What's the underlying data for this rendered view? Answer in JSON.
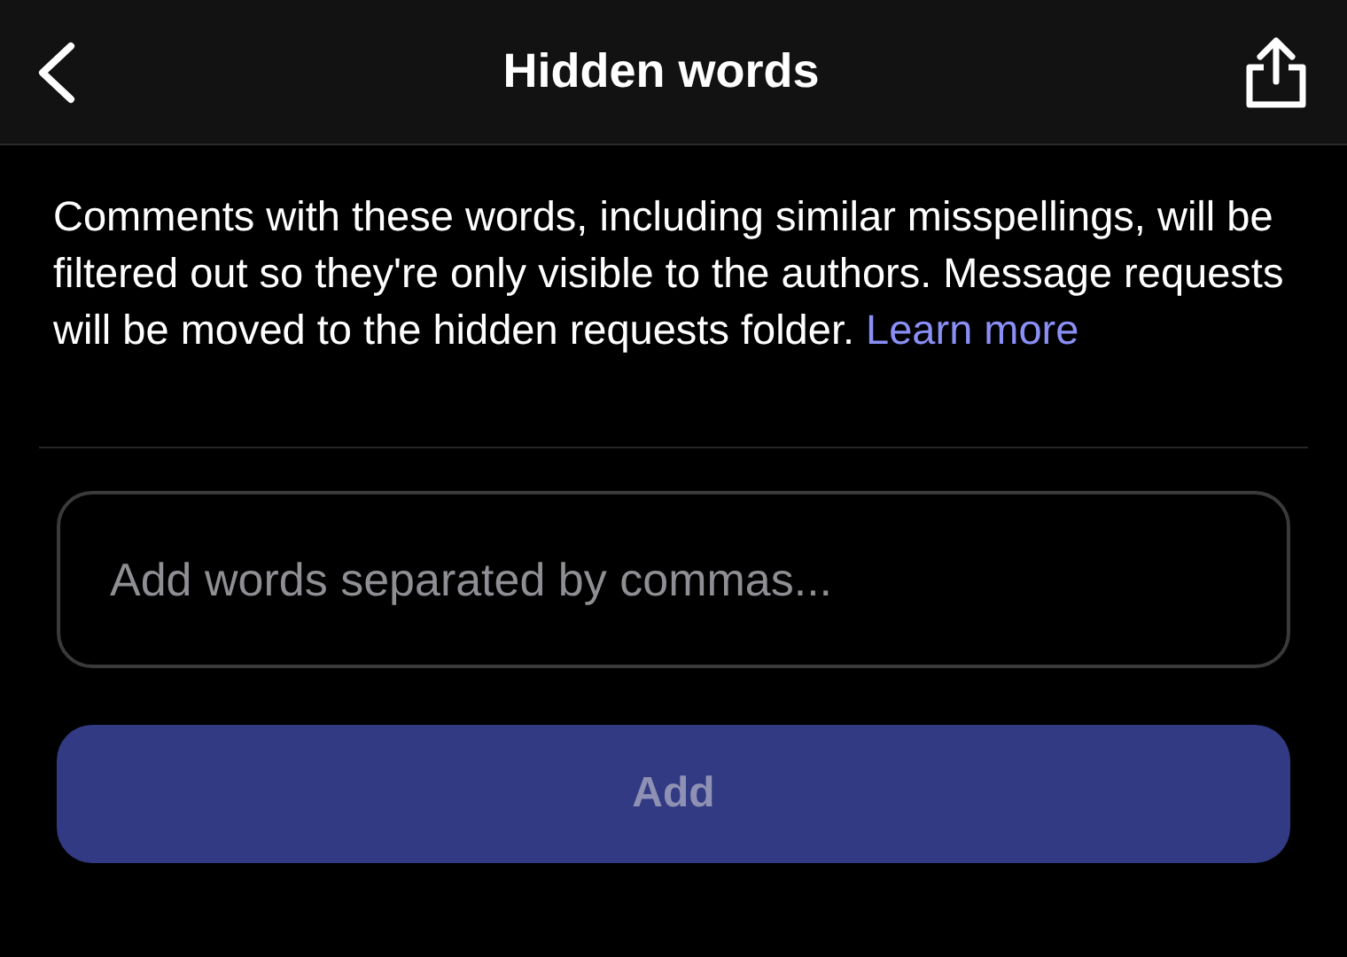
{
  "header": {
    "title": "Hidden words"
  },
  "description": {
    "text": "Comments with these words, including similar misspellings, will be filtered out so they're only visible to the authors. Message requests will be moved to the hidden requests folder.",
    "link": "Learn more"
  },
  "input": {
    "placeholder": "Add words separated by commas..."
  },
  "add_button": {
    "label": "Add",
    "disabled": true
  }
}
